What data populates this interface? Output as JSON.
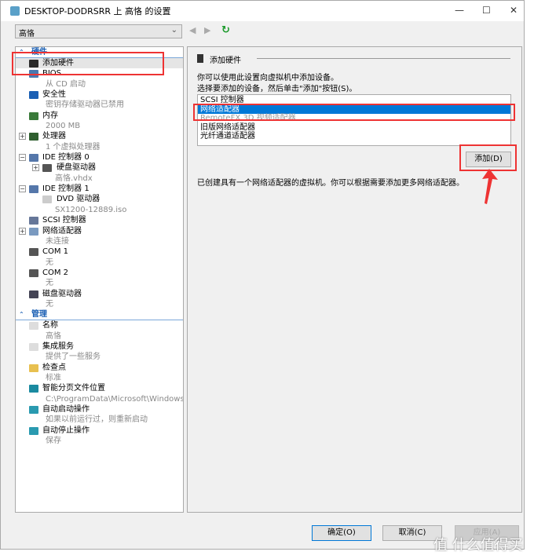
{
  "window": {
    "title": "DESKTOP-DODRSRR 上 高恪 的设置",
    "minimize": "—",
    "maximize": "☐",
    "close": "✕"
  },
  "toolbar": {
    "vm_select": "高恪",
    "back": "◀",
    "forward": "▶",
    "refresh": "↻"
  },
  "tree": {
    "hardware_header": "硬件",
    "hardware": [
      {
        "title": "添加硬件",
        "icon": "add-hardware-icon",
        "color": "#2a2a2a"
      },
      {
        "title": "BIOS",
        "sub": "从 CD 启动",
        "icon": "bios-icon",
        "color": "#4a78b0"
      },
      {
        "title": "安全性",
        "sub": "密钥存储驱动器已禁用",
        "icon": "shield-icon",
        "color": "#1a5fb4"
      },
      {
        "title": "内存",
        "sub": "2000 MB",
        "icon": "memory-icon",
        "color": "#3a7a3a"
      },
      {
        "title": "处理器",
        "sub": "1 个虚拟处理器",
        "icon": "processor-icon",
        "color": "#2e5e2e",
        "expand": "+"
      },
      {
        "title": "IDE 控制器 0",
        "icon": "ide-controller-icon",
        "color": "#5577aa",
        "expand": "−"
      },
      {
        "title": "硬盘驱动器",
        "sub": "高恪.vhdx",
        "icon": "hard-drive-icon",
        "color": "#555",
        "expand": "+",
        "level": 2
      },
      {
        "title": "IDE 控制器 1",
        "icon": "ide-controller-icon",
        "color": "#5577aa",
        "expand": "−"
      },
      {
        "title": "DVD 驱动器",
        "sub": "SX1200-12889.iso",
        "icon": "dvd-icon",
        "color": "#ccc",
        "level": 2
      },
      {
        "title": "SCSI 控制器",
        "icon": "scsi-controller-icon",
        "color": "#667799"
      },
      {
        "title": "网络适配器",
        "sub": "未连接",
        "icon": "network-adapter-icon",
        "color": "#7a9ac0",
        "expand": "+"
      },
      {
        "title": "COM 1",
        "sub": "无",
        "icon": "com-port-icon",
        "color": "#555"
      },
      {
        "title": "COM 2",
        "sub": "无",
        "icon": "com-port-icon",
        "color": "#555"
      },
      {
        "title": "磁盘驱动器",
        "sub": "无",
        "icon": "floppy-icon",
        "color": "#445"
      }
    ],
    "management_header": "管理",
    "management": [
      {
        "title": "名称",
        "sub": "高恪",
        "icon": "name-icon",
        "color": "#ddd"
      },
      {
        "title": "集成服务",
        "sub": "提供了一些服务",
        "icon": "integration-services-icon",
        "color": "#ddd"
      },
      {
        "title": "检查点",
        "sub": "标准",
        "icon": "checkpoint-icon",
        "color": "#e8c050"
      },
      {
        "title": "智能分页文件位置",
        "sub": "C:\\ProgramData\\Microsoft\\Windows\\Hyper-V",
        "icon": "paging-file-icon",
        "color": "#1a8aa0"
      },
      {
        "title": "自动启动操作",
        "sub": "如果以前运行过，则重新启动",
        "icon": "auto-start-icon",
        "color": "#2a9ab0"
      },
      {
        "title": "自动停止操作",
        "sub": "保存",
        "icon": "auto-stop-icon",
        "color": "#2a9ab0"
      }
    ]
  },
  "panel": {
    "group_title": "添加硬件",
    "intro": "你可以使用此设置向虚拟机中添加设备。",
    "instruction": "选择要添加的设备，然后单击\"添加\"按钮(S)。",
    "devices": [
      {
        "label": "SCSI 控制器"
      },
      {
        "label": "网络适配器",
        "selected": true
      },
      {
        "label": "RemoteFX 3D 视频适配器",
        "disabled": true
      },
      {
        "label": "旧版网络适配器"
      },
      {
        "label": "光纤通道适配器"
      }
    ],
    "add_button": "添加(D)",
    "note": "已创建具有一个网络适配器的虚拟机。你可以根据需要添加更多网络适配器。"
  },
  "footer": {
    "ok": "确定(O)",
    "cancel": "取消(C)",
    "apply": "应用(A)"
  },
  "watermark": "值 什么值得买",
  "colors": {
    "selection": "#0078d7",
    "annotation": "#ee3333",
    "section_header": "#1a5fb4"
  }
}
